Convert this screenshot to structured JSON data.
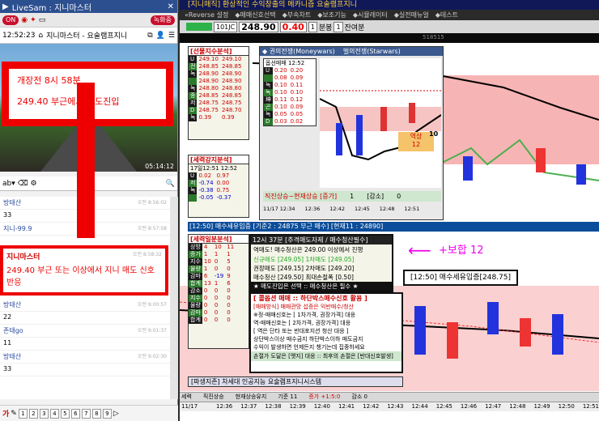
{
  "left": {
    "title": "LiveSam : 지니마스터",
    "on_label": "ON",
    "record_label": "녹화중",
    "clock": "12:52:23",
    "room_title": "지니마스터 - 요술램프지니",
    "video_time": "05:14:12",
    "overlay_line1": "개장전 8시 58분",
    "overlay_line2": "249.40 부근에서 매도진입",
    "messages": [
      {
        "name": "방태산",
        "time": "오전 8:56:02",
        "text": "33"
      },
      {
        "name": "지니-99.9",
        "time": "오전 8:57:58",
        "text": ""
      },
      {
        "name": "지니마스터",
        "time": "오전 8:58:32",
        "text": "249.40 부근 또는 이상에서 지니 매도 신호 반응",
        "hl": true
      },
      {
        "name": "방태산",
        "time": "오전 9:00:57",
        "text": "22"
      },
      {
        "name": "존태go",
        "time": "오전 9:01:37",
        "text": "11"
      },
      {
        "name": "방태산",
        "time": "오전 9:02:30",
        "text": "33"
      }
    ],
    "pages": [
      "1",
      "2",
      "3",
      "4",
      "5",
      "6",
      "7",
      "8",
      "9"
    ],
    "font_label": "가"
  },
  "right": {
    "title": "[지니매직] 환상적인 수익창출의 메카니즘 요술램프지니",
    "menu": [
      "«Reverse 설정",
      "◆매매신호선택",
      "◆부속차트",
      "◆보조기능",
      "◆시뮬레이터",
      "◆실전매뉴얼",
      "◆테스트"
    ],
    "code": "101JC",
    "price": "248.90",
    "change": "0.40",
    "period": "1",
    "period_unit": "분봉",
    "count": "1",
    "count_label": "잔여분",
    "sub_price": "518515",
    "panel_signal": {
      "title": "[선물지수분석]",
      "rows": [
        [
          "U",
          "249.10",
          "249.10"
        ],
        [
          "전",
          "248.85",
          "248.85"
        ],
        [
          "녹",
          "248.90",
          "248.90"
        ],
        [
          "",
          "248.90",
          "248.90"
        ],
        [
          "녹",
          "248.80",
          "248.80"
        ],
        [
          "종",
          "248.85",
          "248.85"
        ],
        [
          "저",
          "248.75",
          "248.75"
        ],
        [
          "D",
          "248.75",
          "248.70"
        ],
        [
          "녹",
          "0.39",
          "0.39"
        ]
      ]
    },
    "panel_power": {
      "title": "◆ 권의전쟁(Moneywars)",
      "title2": "벌의전쟁(Starwars)",
      "head": "옵선매매",
      "time": "12:52",
      "rows": [
        [
          "U",
          "0.20",
          "0.20"
        ],
        [
          "",
          "0.08",
          "0.09"
        ],
        [
          "녹",
          "0.10",
          "0.11"
        ],
        [
          "녹",
          "0.10",
          "0.10"
        ],
        [
          "坤",
          "0.11",
          "0.12"
        ],
        [
          "곤",
          "0.10",
          "0.09"
        ],
        [
          "녹",
          "0.05",
          "0.05"
        ],
        [
          "D",
          "0.03",
          "0.02"
        ]
      ],
      "footer": "직진상승~현재상승 [증가]",
      "f1": "1",
      "f2": "[감소]",
      "f3": "0",
      "times": [
        "11/17 12:34",
        "12:36",
        "12:42",
        "12:45",
        "12:48",
        "12:51"
      ]
    },
    "panel_trend": {
      "title": "[세력강지분석]",
      "time1": "17일12:51",
      "time2": "12:52",
      "rows": [
        [
          "U",
          "0.02",
          "0.97"
        ],
        [
          "저",
          "-0.74",
          "0.00"
        ],
        [
          "녹",
          "-0.38",
          "0.75"
        ],
        [
          "",
          "-0.05",
          "-0.37"
        ]
      ]
    },
    "notice": "[12:50] 매수세유입증 [기준2 : 24875 부근 매수] [현재11 : 24890]",
    "panel_force": {
      "title": "[세력일분분석]",
      "rows": [
        [
          "상방",
          "4",
          "10",
          "11"
        ],
        [
          "증가",
          "1",
          "1",
          "1"
        ],
        [
          "지수",
          "10",
          "0",
          "5"
        ],
        [
          "물량",
          "1",
          "0",
          "0"
        ],
        [
          "감마",
          "6",
          "-19",
          "9"
        ],
        [
          "합계",
          "13",
          "1",
          "6"
        ],
        [
          "감소",
          "0",
          "0",
          "0"
        ],
        [
          "지수",
          "0",
          "0",
          "0"
        ],
        [
          "물량",
          "0",
          "0",
          "0"
        ],
        [
          "감마",
          "0",
          "0",
          "0"
        ],
        [
          "합계",
          "0",
          "0",
          "0"
        ]
      ]
    },
    "panel_order": {
      "title": "12시 37분 [추격매도자제 / 매수청산필수]",
      "lines": [
        "역매도! 매수청산은 249.00 이상에서 진행",
        "신규매도 [249.05]  1차매도 [249.05]",
        "권장매도 [249.15]  2차매도 [249.20]",
        "매수청산 [249.50]  최대손절폭 [0.50]",
        "★ 매도진입은 선택 :: 매수청산은 필수 ★"
      ]
    },
    "annot1": "+보합 12",
    "annot2": "[12:50] 매수세유입증[248.75]",
    "panel_rule": {
      "title": "[ 콜옵션 매매 :: 하단박스매수신호 활용 ]",
      "lines": [
        "[매매방식] 매매관망 섭증은 익반매수/청산",
        "※정-매매신호는 [ 1차가격, 권장가격] 대응",
        "역-매매신호는 [ 2차가격, 권장가격] 대응",
        "[ 역은 단타 또는 반대포지션 청산 대응 ]",
        "상단박스이상 매수금지 하단박스이하 매도금지",
        "수익이 발생하면 언제든지 챙기는데 집중하세요"
      ],
      "loss": "손절가 도달은 [옛지] 대응 :: 최후의 손절은 [반대신호발생]",
      "footer": "[파생지존] 차세대 인공지능 요술램프지니시스템"
    },
    "side_label": "역상",
    "side_val": "12",
    "mid_val": "10",
    "bottom": [
      "세력",
      "직진상승",
      "현재상승유지",
      "기준 11",
      "증가 +1:5:0",
      "감소 0"
    ],
    "axis": [
      "11/17 12:34",
      "12:36",
      "12:37",
      "12:38",
      "12:39",
      "12:40",
      "12:41",
      "12:42",
      "12:43",
      "12:44",
      "12:45",
      "12:46",
      "12:47",
      "12:48",
      "12:49",
      "12:50",
      "12:51"
    ]
  }
}
